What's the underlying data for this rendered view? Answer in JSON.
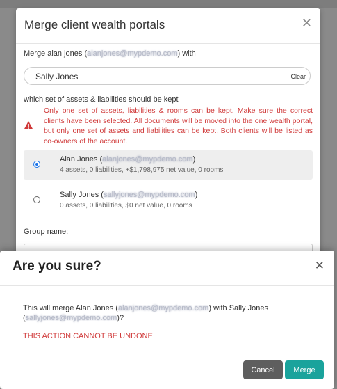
{
  "merge_modal": {
    "title": "Merge client wealth portals",
    "merge_prefix": "Merge alan jones (",
    "merge_email": "alanjones@mypdemo.com",
    "merge_suffix": ") with",
    "client_value": "Sally Jones",
    "clear_label": "Clear",
    "which_label": "which set of assets & liabilities should be kept",
    "warning_text": "Only one set of assets, liabilities & rooms can be kept. Make sure the correct clients have been selected. All documents will be moved into the one wealth portal, but only one set of assets and liabilities can be kept. Both clients will be listed as co-owners of the account.",
    "options": [
      {
        "name": "Alan Jones (",
        "email": "alanjones@mypdemo.com",
        "close": ")",
        "summary": "4 assets, 0 liabilities, +$1,798,975 net value, 0 rooms",
        "selected": true
      },
      {
        "name": "Sally Jones (",
        "email": "sallyjones@mypdemo.com",
        "close": ")",
        "summary": "0 assets, 0 liabilities, $0 net value, 0 rooms",
        "selected": false
      }
    ],
    "group_label": "Group name:"
  },
  "confirm_modal": {
    "title": "Are you sure?",
    "body_prefix": "This will merge Alan Jones (",
    "body_email1": "alanjones@mypdemo.com",
    "body_mid": ") with Sally Jones (",
    "body_email2": "sallyjones@mypdemo.com",
    "body_suffix": ")?",
    "warning": "THIS ACTION CANNOT BE UNDONE",
    "cancel_label": "Cancel",
    "merge_label": "Merge"
  },
  "colors": {
    "danger": "#d03a3a",
    "merge_button": "#1aa39c",
    "cancel_button": "#5e5e5e",
    "radio_accent": "#1a73e8"
  }
}
